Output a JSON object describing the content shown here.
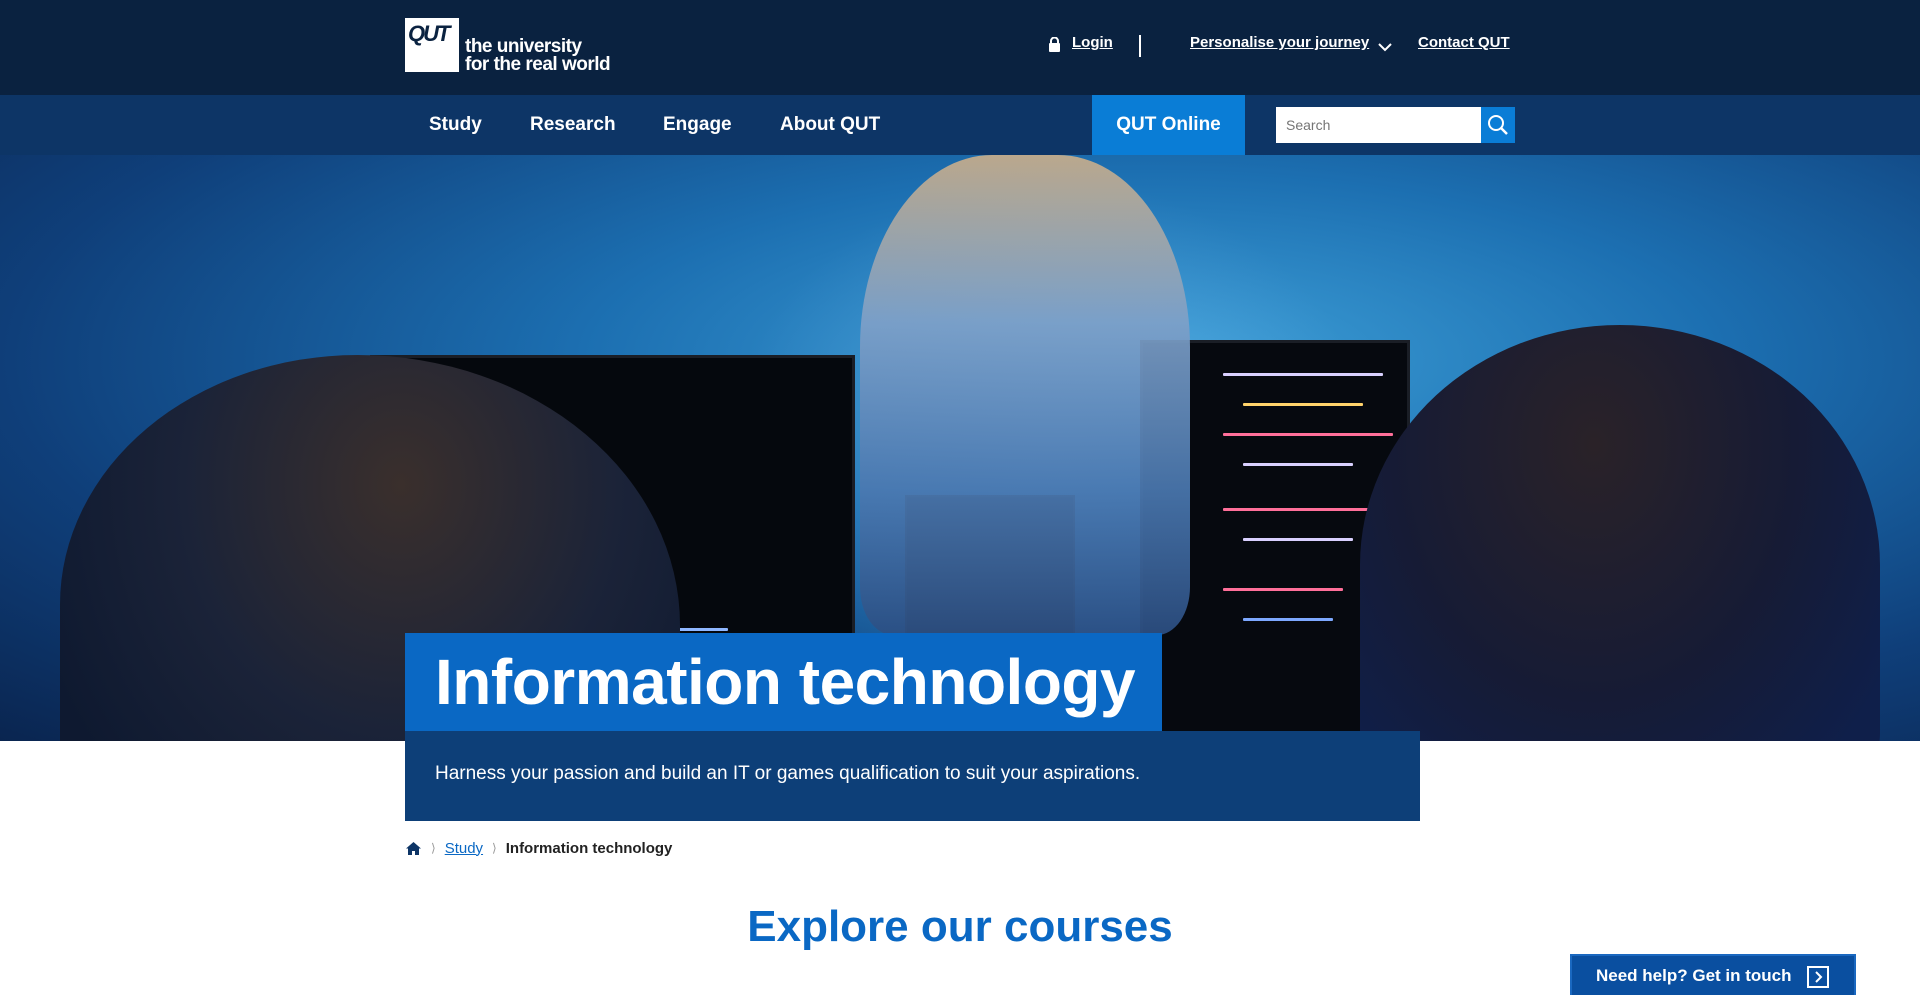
{
  "header": {
    "logo_mark": "QUT",
    "logo_line1": "the university",
    "logo_line2": "for the real world",
    "login": "Login",
    "personalise": "Personalise your journey",
    "contact": "Contact QUT"
  },
  "nav": {
    "items": [
      "Study",
      "Research",
      "Engage",
      "About QUT"
    ],
    "qut_online": "QUT Online",
    "search_placeholder": "Search"
  },
  "hero": {
    "title": "Information technology",
    "subtitle": "Harness your passion and build an IT or games qualification to suit your aspirations."
  },
  "breadcrumb": {
    "study": "Study",
    "current": "Information technology"
  },
  "main": {
    "heading": "Explore our courses"
  },
  "help": {
    "label": "Need help? Get in touch"
  },
  "colors": {
    "dark_navy": "#0a2240",
    "nav_blue": "#0d3566",
    "accent_blue": "#0a68c4",
    "online_blue": "#0a7dd6"
  }
}
